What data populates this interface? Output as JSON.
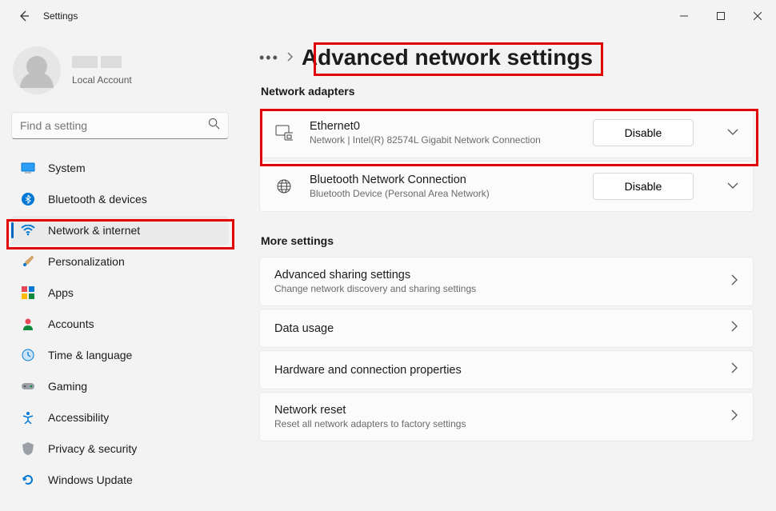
{
  "window": {
    "title": "Settings"
  },
  "account": {
    "subtitle": "Local Account"
  },
  "search": {
    "placeholder": "Find a setting"
  },
  "sidebar": {
    "items": [
      {
        "label": "System"
      },
      {
        "label": "Bluetooth & devices"
      },
      {
        "label": "Network & internet"
      },
      {
        "label": "Personalization"
      },
      {
        "label": "Apps"
      },
      {
        "label": "Accounts"
      },
      {
        "label": "Time & language"
      },
      {
        "label": "Gaming"
      },
      {
        "label": "Accessibility"
      },
      {
        "label": "Privacy & security"
      },
      {
        "label": "Windows Update"
      }
    ]
  },
  "breadcrumb": {
    "page_title": "Advanced network settings"
  },
  "sections": {
    "adapters_heading": "Network adapters",
    "more_heading": "More settings"
  },
  "adapters": [
    {
      "name": "Ethernet0",
      "desc": "Network | Intel(R) 82574L Gigabit Network Connection",
      "button": "Disable"
    },
    {
      "name": "Bluetooth Network Connection",
      "desc": "Bluetooth Device (Personal Area Network)",
      "button": "Disable"
    }
  ],
  "more": [
    {
      "label": "Advanced sharing settings",
      "sub": "Change network discovery and sharing settings"
    },
    {
      "label": "Data usage",
      "sub": ""
    },
    {
      "label": "Hardware and connection properties",
      "sub": ""
    },
    {
      "label": "Network reset",
      "sub": "Reset all network adapters to factory settings"
    }
  ]
}
